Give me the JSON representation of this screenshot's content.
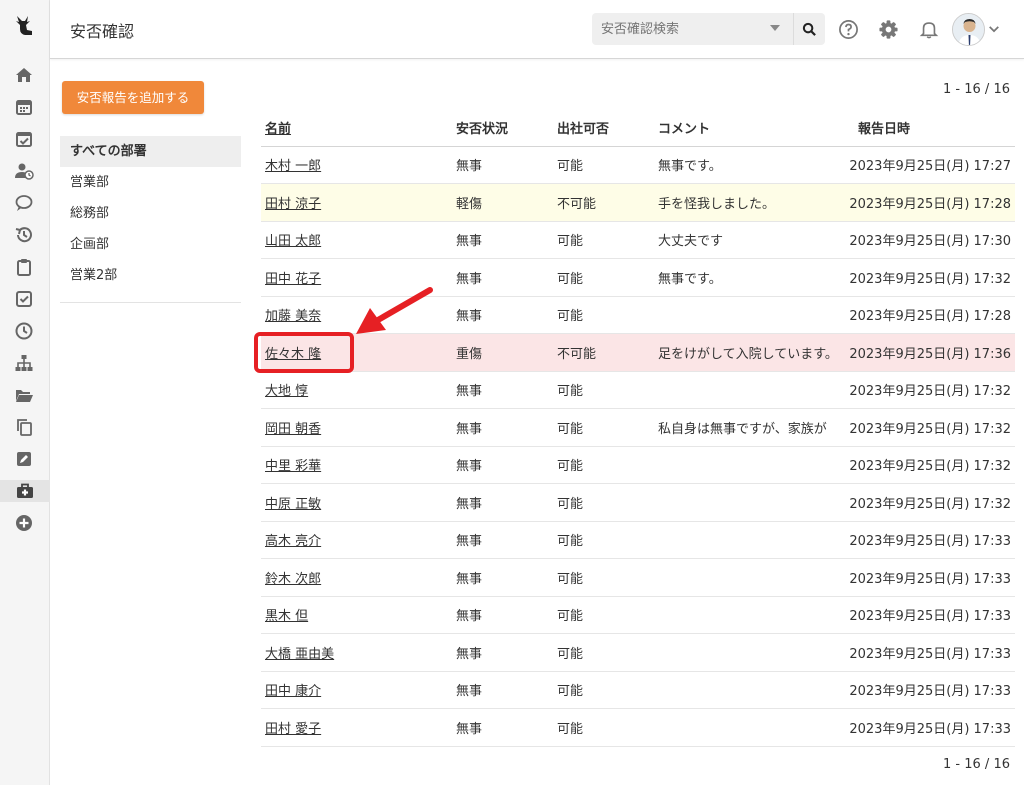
{
  "header": {
    "title": "安否確認",
    "search_placeholder": "安否確認検索"
  },
  "actions": {
    "add_report": "安否報告を追加する"
  },
  "departments": [
    {
      "label": "すべての部署",
      "active": true
    },
    {
      "label": "営業部",
      "active": false
    },
    {
      "label": "総務部",
      "active": false
    },
    {
      "label": "企画部",
      "active": false
    },
    {
      "label": "営業2部",
      "active": false
    }
  ],
  "pagination": {
    "top": "1 - 16 / 16",
    "bottom": "1 - 16 / 16"
  },
  "table": {
    "columns": [
      "名前",
      "安否状況",
      "出社可否",
      "コメント",
      "報告日時"
    ],
    "rows": [
      {
        "name": "木村 一郎",
        "status": "無事",
        "attend": "可能",
        "comment": "無事です。",
        "date": "2023年9月25日(月) 17:27",
        "highlight": ""
      },
      {
        "name": "田村 涼子",
        "status": "軽傷",
        "attend": "不可能",
        "comment": "手を怪我しました。",
        "date": "2023年9月25日(月) 17:28",
        "highlight": "yellow"
      },
      {
        "name": "山田 太郎",
        "status": "無事",
        "attend": "可能",
        "comment": "大丈夫です",
        "date": "2023年9月25日(月) 17:30",
        "highlight": ""
      },
      {
        "name": "田中 花子",
        "status": "無事",
        "attend": "可能",
        "comment": "無事です。",
        "date": "2023年9月25日(月) 17:32",
        "highlight": ""
      },
      {
        "name": "加藤 美奈",
        "status": "無事",
        "attend": "可能",
        "comment": "",
        "date": "2023年9月25日(月) 17:28",
        "highlight": ""
      },
      {
        "name": "佐々木 隆",
        "status": "重傷",
        "attend": "不可能",
        "comment": "足をけがして入院しています。",
        "date": "2023年9月25日(月) 17:36",
        "highlight": "red"
      },
      {
        "name": "大地 惇",
        "status": "無事",
        "attend": "可能",
        "comment": "",
        "date": "2023年9月25日(月) 17:32",
        "highlight": ""
      },
      {
        "name": "岡田 朝香",
        "status": "無事",
        "attend": "可能",
        "comment": "私自身は無事ですが、家族が",
        "date": "2023年9月25日(月) 17:32",
        "highlight": ""
      },
      {
        "name": "中里 彩華",
        "status": "無事",
        "attend": "可能",
        "comment": "",
        "date": "2023年9月25日(月) 17:32",
        "highlight": ""
      },
      {
        "name": "中原 正敏",
        "status": "無事",
        "attend": "可能",
        "comment": "",
        "date": "2023年9月25日(月) 17:32",
        "highlight": ""
      },
      {
        "name": "高木 亮介",
        "status": "無事",
        "attend": "可能",
        "comment": "",
        "date": "2023年9月25日(月) 17:33",
        "highlight": ""
      },
      {
        "name": "鈴木 次郎",
        "status": "無事",
        "attend": "可能",
        "comment": "",
        "date": "2023年9月25日(月) 17:33",
        "highlight": ""
      },
      {
        "name": "黒木 但",
        "status": "無事",
        "attend": "可能",
        "comment": "",
        "date": "2023年9月25日(月) 17:33",
        "highlight": ""
      },
      {
        "name": "大橋 亜由美",
        "status": "無事",
        "attend": "可能",
        "comment": "",
        "date": "2023年9月25日(月) 17:33",
        "highlight": ""
      },
      {
        "name": "田中 康介",
        "status": "無事",
        "attend": "可能",
        "comment": "",
        "date": "2023年9月25日(月) 17:33",
        "highlight": ""
      },
      {
        "name": "田村 愛子",
        "status": "無事",
        "attend": "可能",
        "comment": "",
        "date": "2023年9月25日(月) 17:33",
        "highlight": ""
      }
    ]
  },
  "rail_icons": [
    "logo-icon",
    "home-icon",
    "calendar-icon",
    "calendar-check-icon",
    "user-clock-icon",
    "chat-icon",
    "history-icon",
    "clipboard-icon",
    "checkbox-icon",
    "clock-icon",
    "org-chart-icon",
    "folder-open-icon",
    "copy-icon",
    "edit-icon",
    "first-aid-kit-icon",
    "add-circle-icon"
  ],
  "header_icons": [
    "search-icon",
    "help-icon",
    "gear-icon",
    "bell-icon",
    "avatar",
    "chevron-down-icon"
  ],
  "colors": {
    "accent": "#f0883a",
    "row_warning": "#fefde7",
    "row_danger": "#fbe5e6",
    "annotation": "#e62024"
  }
}
